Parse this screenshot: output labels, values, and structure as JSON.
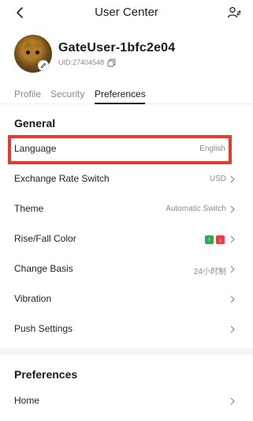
{
  "header": {
    "title": "User Center"
  },
  "profile": {
    "username": "GateUser-1bfc2e04",
    "uid": "UID:27404548"
  },
  "tabs": [
    {
      "label": "Profile",
      "active": false
    },
    {
      "label": "Security",
      "active": false
    },
    {
      "label": "Preferences",
      "active": true
    }
  ],
  "general": {
    "title": "General",
    "rows": [
      {
        "label": "Language",
        "value": "English",
        "highlighted": true
      },
      {
        "label": "Exchange Rate Switch",
        "value": "USD"
      },
      {
        "label": "Theme",
        "value": "Automatic Switch"
      },
      {
        "label": "Rise/Fall Color",
        "value": ""
      },
      {
        "label": "Change Basis",
        "value": "24小时制"
      },
      {
        "label": "Vibration",
        "value": ""
      },
      {
        "label": "Push Settings",
        "value": ""
      }
    ]
  },
  "preferences": {
    "title": "Preferences",
    "rows": [
      {
        "label": "Home",
        "value": ""
      }
    ]
  },
  "colors": {
    "highlight": "#e23d2a",
    "rise": "#33a852",
    "fall": "#e2414a"
  },
  "icons": {
    "back": "chevron-left-icon",
    "user_switch": "user-switch-icon",
    "copy": "copy-icon",
    "edit": "edit-pencil-icon",
    "row_arrow": "chevron-right-icon",
    "rise": "arrow-up-icon",
    "fall": "arrow-down-icon"
  }
}
